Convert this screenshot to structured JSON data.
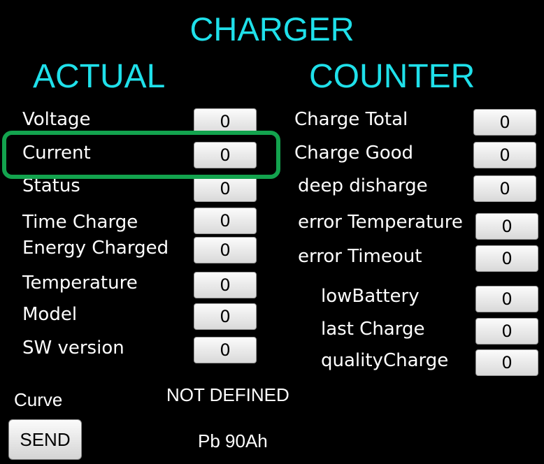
{
  "header": {
    "title": "CHARGER",
    "actual_title": "ACTUAL",
    "counter_title": "COUNTER"
  },
  "actual": [
    {
      "label": "Voltage",
      "value": "0"
    },
    {
      "label": "Current",
      "value": "0"
    },
    {
      "label": "Status",
      "value": "0"
    },
    {
      "label": "Time Charge",
      "value": "0"
    },
    {
      "label": "Energy Charged",
      "value": "0"
    },
    {
      "label": "Temperature",
      "value": "0"
    },
    {
      "label": "Model",
      "value": "0"
    },
    {
      "label": "SW version",
      "value": "0"
    }
  ],
  "counter": [
    {
      "label": "Charge Total",
      "value": "0"
    },
    {
      "label": "Charge Good",
      "value": "0"
    },
    {
      "label": "deep disharge",
      "value": "0"
    },
    {
      "label": "error Temperature",
      "value": "0"
    },
    {
      "label": "error Timeout",
      "value": "0"
    },
    {
      "label": "lowBattery",
      "value": "0"
    },
    {
      "label": "last Charge",
      "value": "0"
    },
    {
      "label": "qualityCharge",
      "value": "0"
    }
  ],
  "curve": {
    "label": "Curve",
    "status": "NOT DEFINED",
    "battery": "Pb 90Ah"
  },
  "send_button": {
    "label": "SEND"
  },
  "colors": {
    "background": "#000000",
    "title": "#1fe0ea",
    "highlight": "#13a34e"
  }
}
